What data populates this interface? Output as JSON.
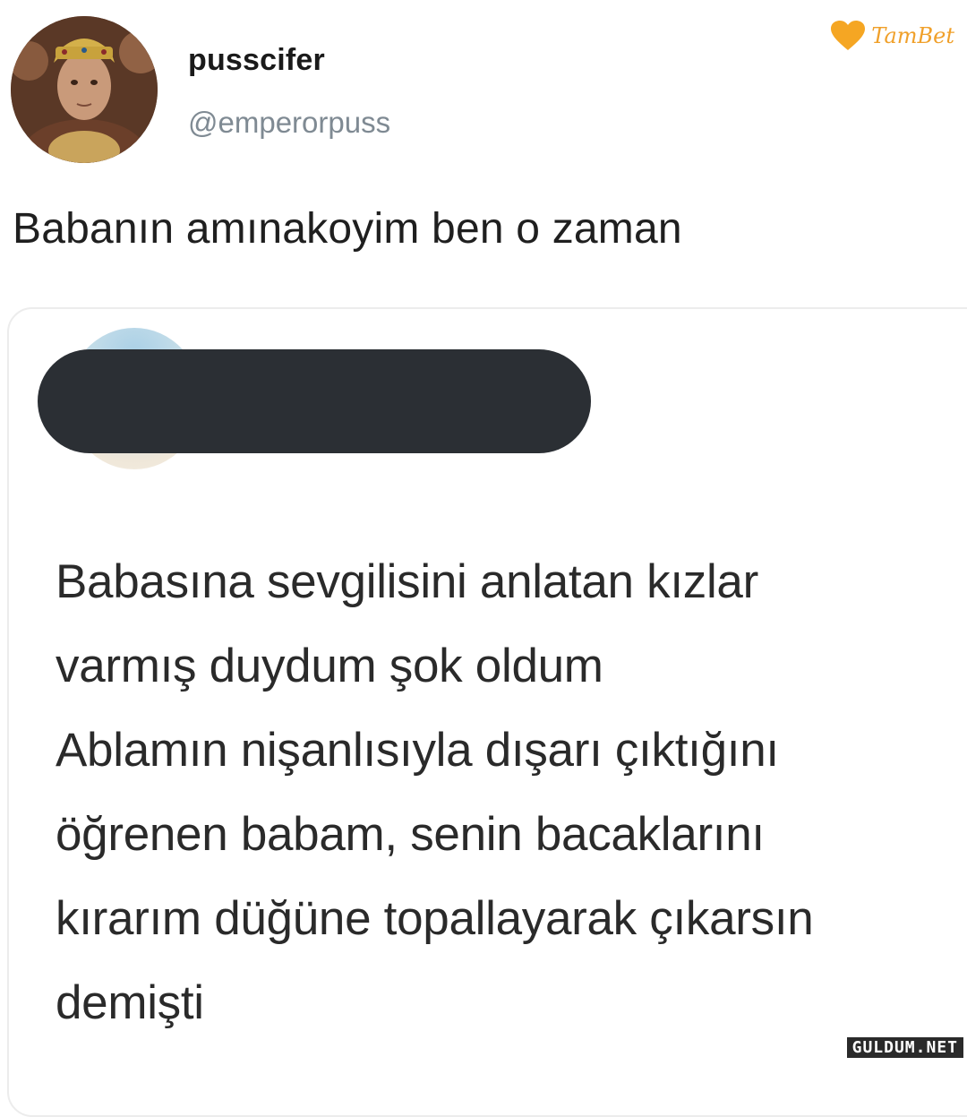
{
  "tweet": {
    "display_name": "pusscifer",
    "handle": "@emperorpuss",
    "text": "Babanın amınakoyim ben o zaman"
  },
  "quoted_tweet": {
    "author_redacted": true,
    "lines": [
      "Babasına sevgilisini anlatan kızlar",
      "varmış duydum şok oldum",
      "Ablamın nişanlısıyla dışarı çıktığını",
      "öğrenen babam, senin bacaklarını",
      "kırarım düğüne topallayarak çıkarsın",
      "demişti"
    ]
  },
  "watermarks": {
    "top_right": "TamBet",
    "bottom_right": "GULDUM.NET"
  },
  "colors": {
    "handle": "#7f8a93",
    "redaction": "#2b2f34",
    "brand_orange": "#f0a02a"
  }
}
